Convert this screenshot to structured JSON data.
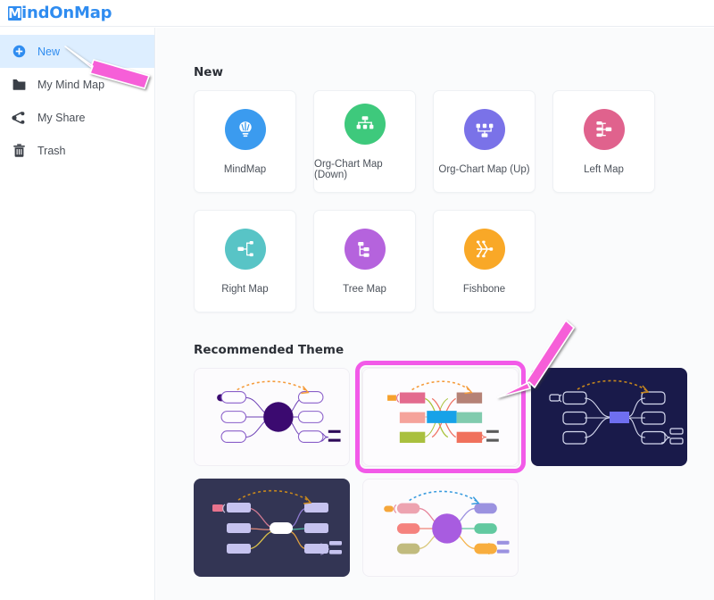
{
  "app": {
    "logo_mark": "M",
    "logo_text": "indOnMap",
    "logo_full": "MindOnMap",
    "brand_color": "#2f8cf0",
    "accent_highlight": "#f25ae8"
  },
  "sidebar": {
    "items": [
      {
        "label": "New",
        "icon": "plus-circle-icon",
        "active": true
      },
      {
        "label": "My Mind Map",
        "icon": "folder-icon",
        "active": false
      },
      {
        "label": "My Share",
        "icon": "share-icon",
        "active": false
      },
      {
        "label": "Trash",
        "icon": "trash-icon",
        "active": false
      }
    ]
  },
  "main": {
    "new_section": {
      "title": "New",
      "cards": [
        {
          "label": "MindMap",
          "icon": "lightbulb-icon",
          "color": "#3b9bef"
        },
        {
          "label": "Org-Chart Map (Down)",
          "icon": "org-chart-down-icon",
          "color": "#3ec97c"
        },
        {
          "label": "Org-Chart Map (Up)",
          "icon": "org-chart-up-icon",
          "color": "#7a72e8"
        },
        {
          "label": "Left Map",
          "icon": "left-map-icon",
          "color": "#e0628d"
        },
        {
          "label": "Right Map",
          "icon": "right-map-icon",
          "color": "#58c4c6"
        },
        {
          "label": "Tree Map",
          "icon": "tree-map-icon",
          "color": "#b563dd"
        },
        {
          "label": "Fishbone",
          "icon": "fishbone-icon",
          "color": "#f9a827"
        }
      ]
    },
    "theme_section": {
      "title": "Recommended Theme",
      "themes": [
        {
          "name": "purple-light-theme",
          "style": "light",
          "selected": false
        },
        {
          "name": "colorful-light-theme",
          "style": "light",
          "selected": true
        },
        {
          "name": "navy-dark-theme",
          "style": "dark-navy",
          "selected": false
        },
        {
          "name": "slate-dark-theme",
          "style": "dark-slate",
          "selected": false
        },
        {
          "name": "pastel-round-theme",
          "style": "light",
          "selected": false
        }
      ]
    }
  },
  "annotations": {
    "arrow_to_new": {
      "name": "pink-arrow-pointing-to-new",
      "color": "#f25ae8"
    },
    "arrow_to_selected_theme": {
      "name": "pink-arrow-pointing-to-selected-theme",
      "color": "#f25ae8"
    }
  }
}
